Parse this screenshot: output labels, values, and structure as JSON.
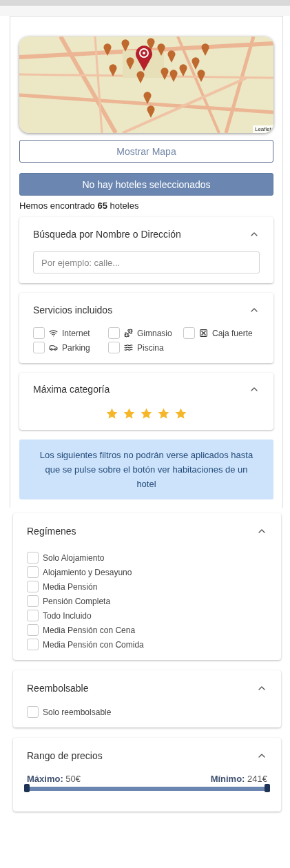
{
  "map": {
    "attribution": "Leaflet"
  },
  "show_map_button": "Mostrar Mapa",
  "selection_banner": "No hay hoteles seleccionados",
  "results_summary": "Hemos encontrado **65** hoteles",
  "name_search": {
    "title": "Búsqueda por Nombre o Dirección",
    "expanded": true,
    "placeholder": "Por ejemplo: calle..."
  },
  "services": {
    "title": "Servicios incluidos",
    "expanded": true,
    "items": [
      {
        "label": "Internet",
        "checked": false
      },
      {
        "label": "Gimnasio",
        "checked": false
      },
      {
        "label": "Caja fuerte",
        "checked": false
      },
      {
        "label": "Parking",
        "checked": false
      },
      {
        "label": "Piscina",
        "checked": false
      }
    ]
  },
  "max_category": {
    "title": "Máxima categoría",
    "expanded": true,
    "stars": 5
  },
  "info_notice": "Los siguientes filtros no podrán verse aplicados hasta que se pulse sobre el botón ver habitaciones de un hotel",
  "board_types": {
    "title": "Regímenes",
    "expanded": true,
    "items": [
      {
        "label": "Solo Alojamiento",
        "checked": false
      },
      {
        "label": "Alojamiento y Desayuno",
        "checked": false
      },
      {
        "label": "Media Pensión",
        "checked": false
      },
      {
        "label": "Pensión Completa",
        "checked": false
      },
      {
        "label": "Todo Incluido",
        "checked": false
      },
      {
        "label": "Media Pensión con Cena",
        "checked": false
      },
      {
        "label": "Media Pensión con Comida",
        "checked": false
      }
    ]
  },
  "refundable": {
    "title": "Reembolsable",
    "expanded": true,
    "items": [
      {
        "label": "Solo reembolsable",
        "checked": false
      }
    ]
  },
  "price_range": {
    "title": "Rango de precios",
    "expanded": true,
    "min_label": "**Máximo:** 50€",
    "max_label": "**Mínimo:** 241€",
    "thumbs": [
      {
        "level": 0
      },
      {
        "level": 1
      }
    ]
  }
}
